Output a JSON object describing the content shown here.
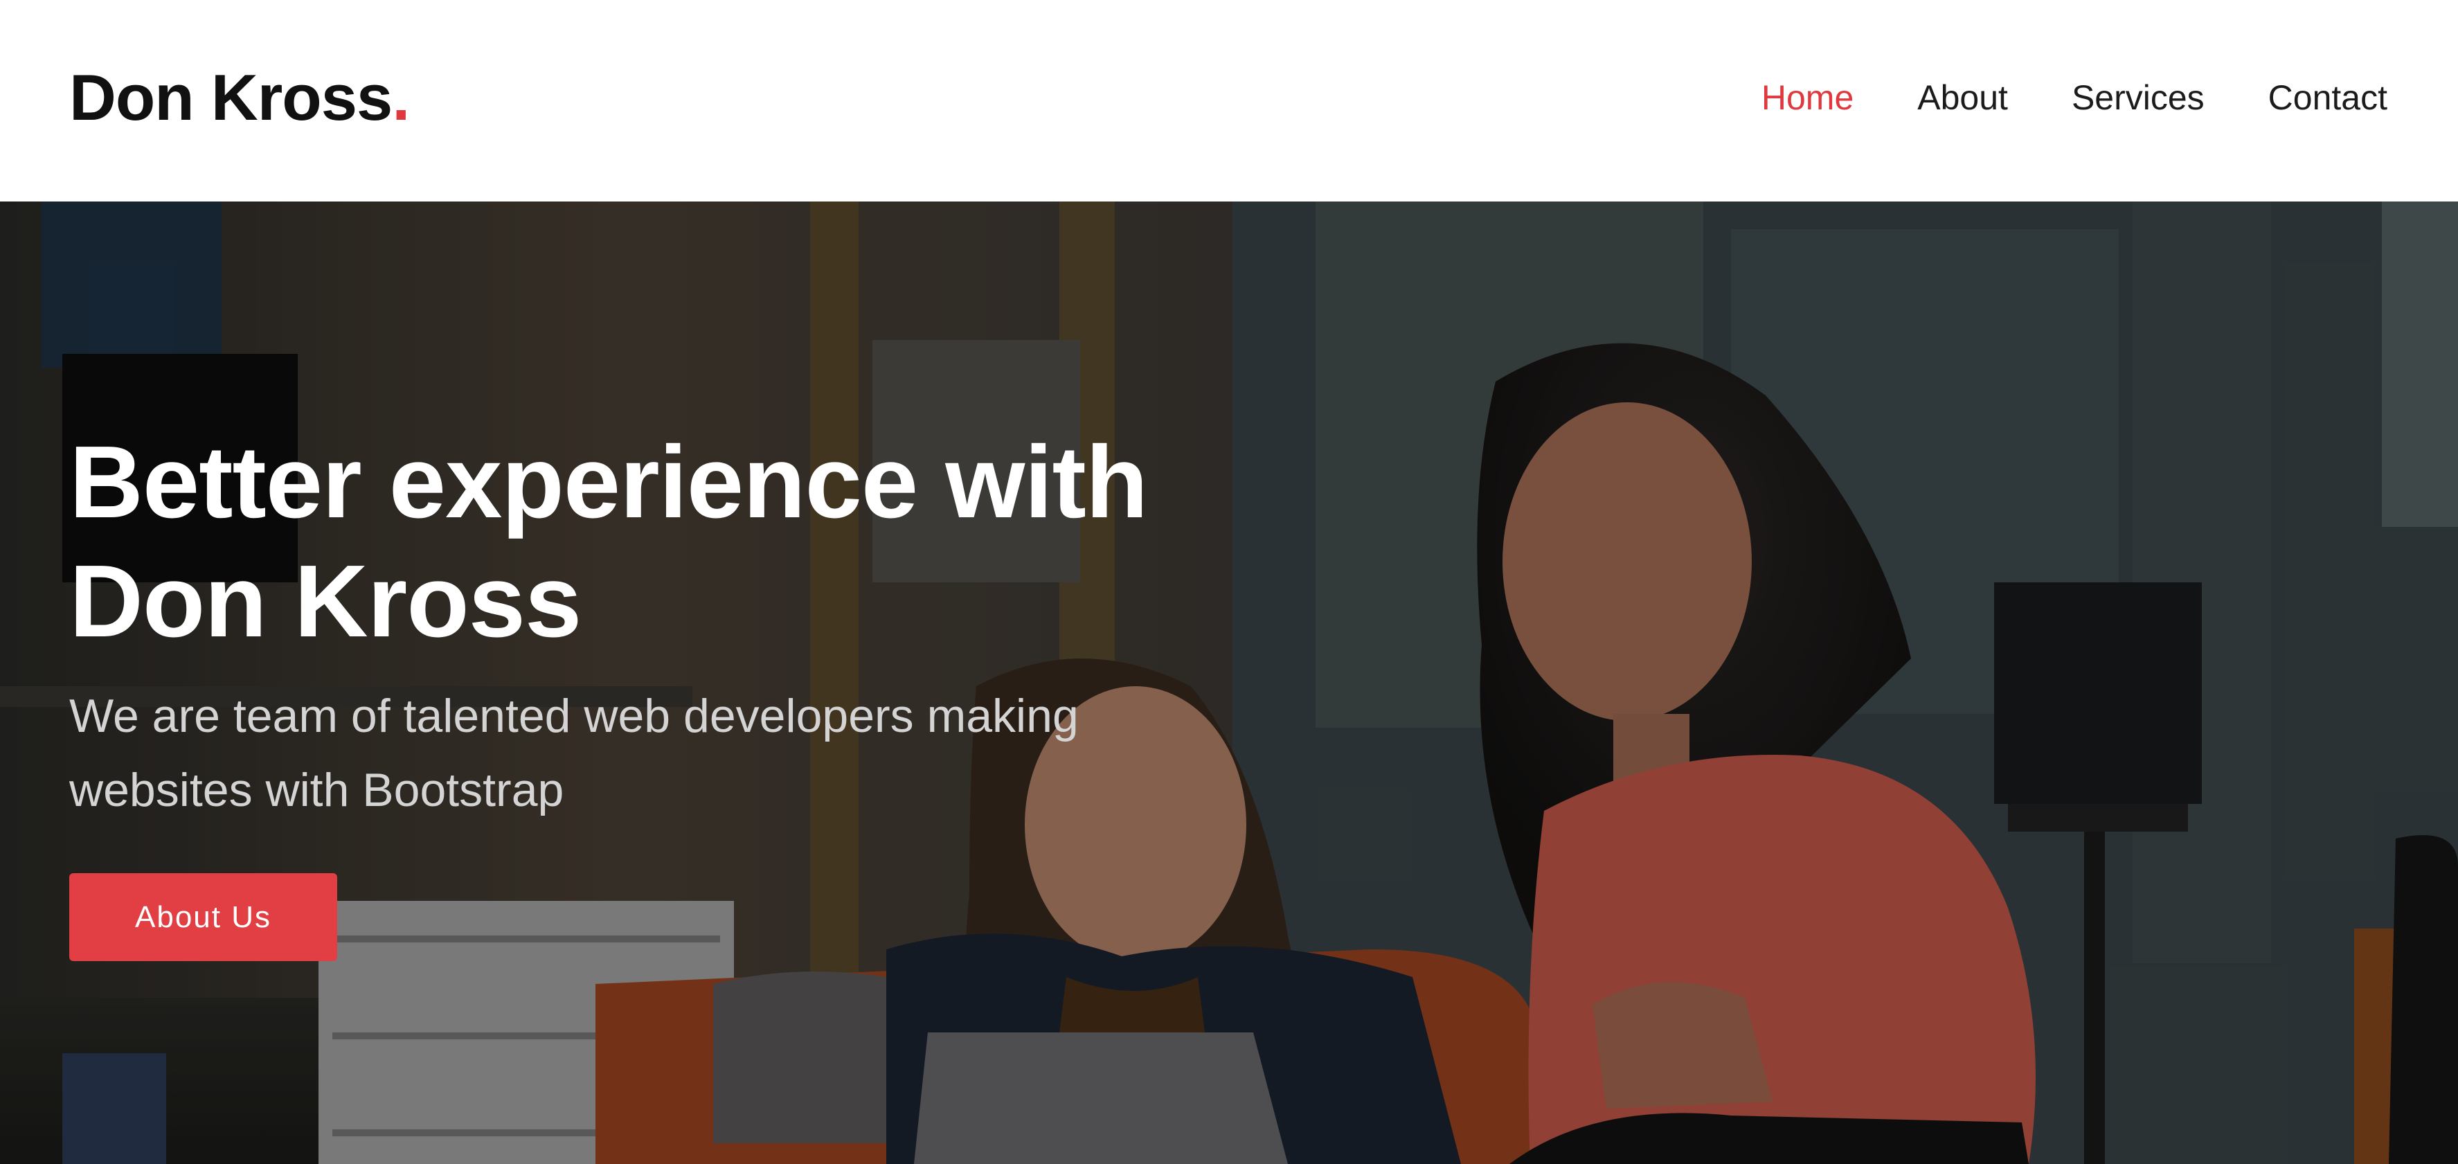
{
  "brand": {
    "name": "Don Kross",
    "dot": "."
  },
  "nav": {
    "items": [
      {
        "label": "Home",
        "active": true
      },
      {
        "label": "About",
        "active": false
      },
      {
        "label": "Services",
        "active": false
      },
      {
        "label": "Contact",
        "active": false
      }
    ]
  },
  "hero": {
    "title_line1": "Better experience with",
    "title_line2": "Don Kross",
    "subtitle_line1": "We are team of talented web developers making",
    "subtitle_line2": "websites with Bootstrap",
    "button_label": "About Us"
  },
  "colors": {
    "accent": "#e0383f",
    "text_dark": "#111111",
    "hero_subtitle": "#d4d4d4"
  }
}
